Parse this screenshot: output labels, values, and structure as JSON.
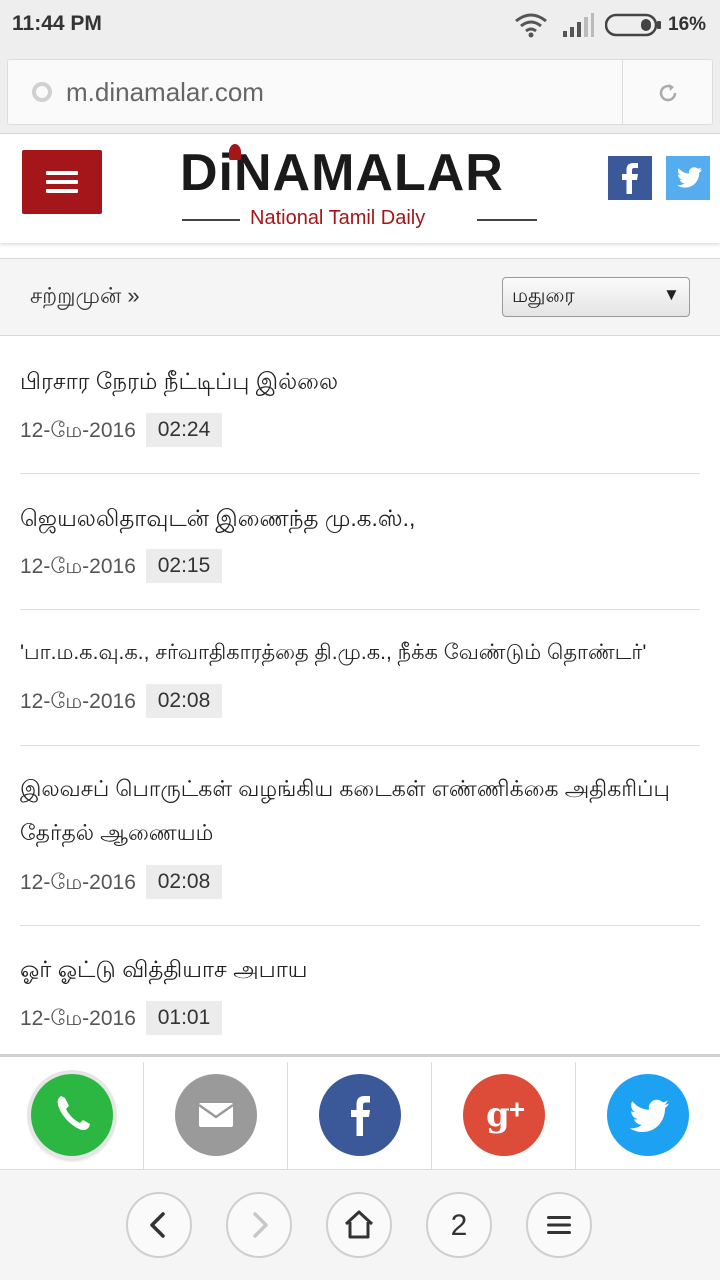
{
  "status_bar": {
    "time": "11:44 PM",
    "battery": "16%"
  },
  "browser": {
    "url": "m.dinamalar.com"
  },
  "header": {
    "logo_title": "DiNAMALAR",
    "logo_tagline": "National Tamil Daily",
    "menu_icon": "hamburger-icon",
    "social_icons": [
      "facebook-icon",
      "twitter-icon"
    ],
    "brand_color": "#a5161a"
  },
  "category_bar": {
    "breadcrumb": "சற்றுமுன் »",
    "select_value": "மதுரை",
    "select_arrow": "▼"
  },
  "news": [
    {
      "title": "பிரசார நேரம் நீட்டிப்பு இல்லை",
      "date": "12-மே-2016",
      "time": "02:24"
    },
    {
      "title": "ஜெயலலிதாவுடன் இணைந்த மு.க.ஸ்.,",
      "date": "12-மே-2016",
      "time": "02:15"
    },
    {
      "title": "'பா.ம.க.வு.க., சர்வாதிகாரத்தை தி.மு.க., நீக்க வேண்டும் தொண்டர்'",
      "date": "12-மே-2016",
      "time": "02:08"
    },
    {
      "title": "இலவசப் பொருட்கள் வழங்கிய கடைகள் எண்ணிக்கை அதிகரிப்பு தேர்தல் ஆணையம்",
      "date": "12-மே-2016",
      "time": "02:08"
    },
    {
      "title": "ஓர் ஓட்டு வித்தியாச அபாய",
      "date": "12-மே-2016",
      "time": "01:01"
    }
  ],
  "share_bar": {
    "items": [
      {
        "icon": "whatsapp-icon",
        "color": "#2cb742"
      },
      {
        "icon": "email-icon",
        "color": "#9a9a9a"
      },
      {
        "icon": "facebook-icon",
        "color": "#3b5998"
      },
      {
        "icon": "google-plus-icon",
        "color": "#dd4b39"
      },
      {
        "icon": "twitter-icon",
        "color": "#1da1f2"
      }
    ]
  },
  "nav_bar": {
    "tab_count": "2",
    "icons": [
      "back-icon",
      "forward-icon",
      "home-icon",
      "tabs-icon",
      "menu-icon"
    ]
  }
}
